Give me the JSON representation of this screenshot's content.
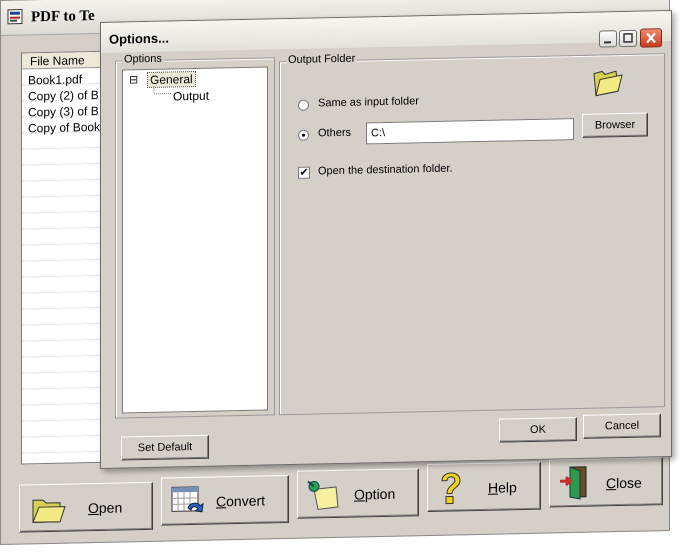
{
  "main": {
    "title": "PDF to Te",
    "file_list": {
      "header": "File Name",
      "rows": [
        "Book1.pdf",
        "Copy (2) of B",
        "Copy (3) of B",
        "Copy of Book"
      ]
    },
    "buttons": {
      "open": {
        "pre": "",
        "u": "O",
        "post": "pen"
      },
      "convert": {
        "pre": "",
        "u": "C",
        "post": "onvert"
      },
      "option": {
        "pre": "",
        "u": "O",
        "post": "ption"
      },
      "help": {
        "pre": "",
        "u": "H",
        "post": "elp"
      },
      "close": {
        "pre": "",
        "u": "C",
        "post": "lose"
      }
    }
  },
  "dialog": {
    "title": "Options...",
    "options_group": "Options",
    "tree": {
      "root": "General",
      "root_toggle": "⊟",
      "child": "Output"
    },
    "output_group": "Output Folder",
    "same_as_input": "Same as input folder",
    "others": "Others",
    "path_value": "C:\\",
    "browser_button": "Browser",
    "open_destination": "Open the destination folder.",
    "set_default": "Set Default",
    "ok": "OK",
    "cancel": "Cancel",
    "radio_selected": "others",
    "open_destination_checked": true
  },
  "colors": {
    "face": "#d4d0c8",
    "close_button": "#d44a2c",
    "selection": "#0a246a"
  },
  "icons": {
    "app": "pdf-app-icon",
    "folder": "folder-open-icon",
    "convert": "convert-grid-icon",
    "option": "note-pin-icon",
    "help": "question-icon",
    "close": "exit-door-icon"
  }
}
